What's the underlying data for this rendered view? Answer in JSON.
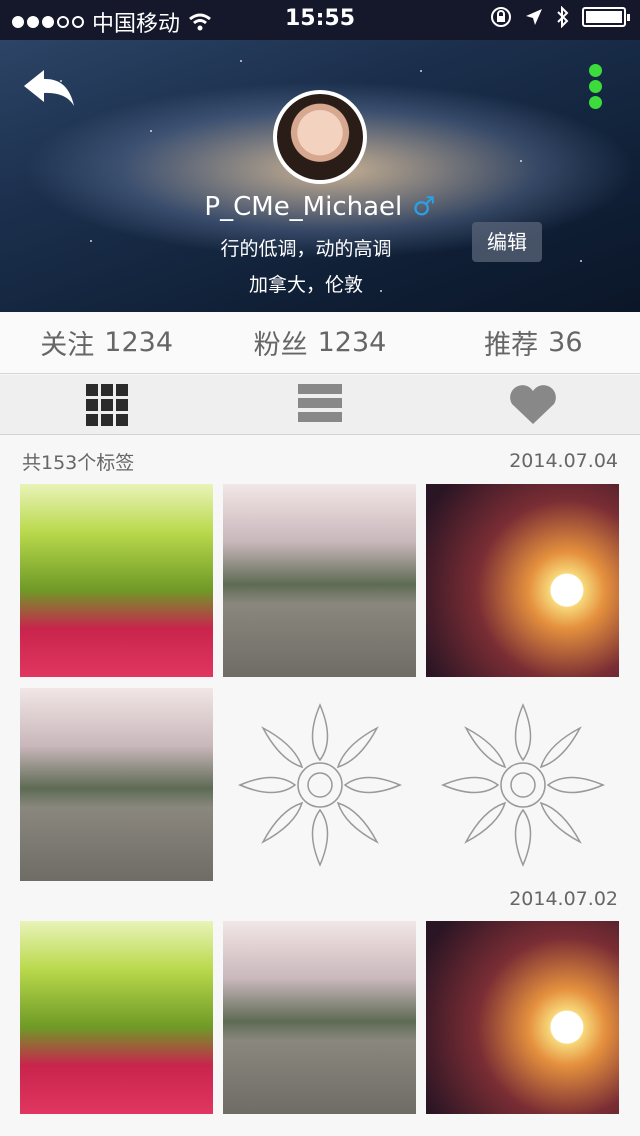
{
  "status_bar": {
    "carrier": "中国移动",
    "time": "15:55"
  },
  "profile": {
    "username": "P_CMe_Michael",
    "gender_symbol": "♂",
    "signature_line1": "行的低调，动的高调",
    "signature_line2": "加拿大，伦敦",
    "edit_label": "编辑"
  },
  "stats": {
    "following_label": "关注",
    "following_count": "1234",
    "followers_label": "粉丝",
    "followers_count": "1234",
    "recommend_label": "推荐",
    "recommend_count": "36"
  },
  "content": {
    "tag_count": "共153个标签",
    "date1": "2014.07.04",
    "date2": "2014.07.02"
  },
  "colors": {
    "status_bar_bg": "#14182a",
    "menu_dots": "#3ddc3d",
    "gender": "#2aa0e6"
  }
}
